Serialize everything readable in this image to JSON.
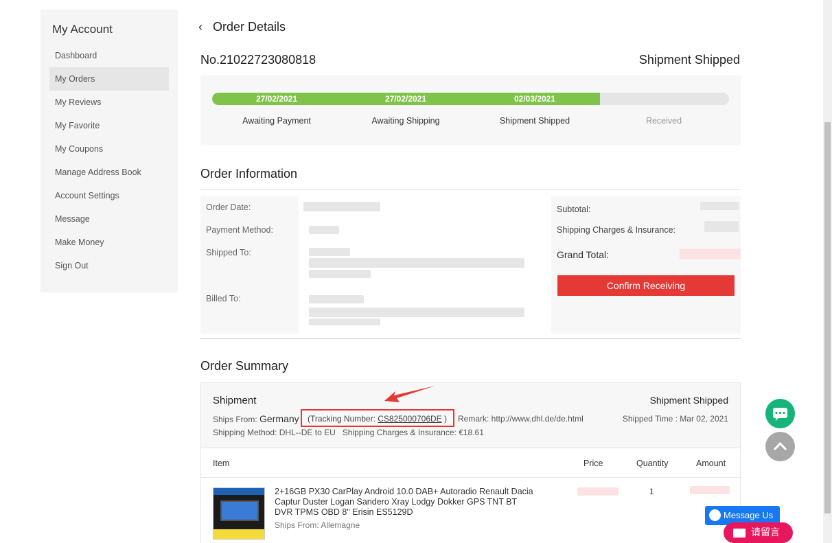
{
  "sidebar": {
    "title": "My Account",
    "items": [
      {
        "label": "Dashboard"
      },
      {
        "label": "My Orders"
      },
      {
        "label": "My Reviews"
      },
      {
        "label": "My Favorite"
      },
      {
        "label": "My Coupons"
      },
      {
        "label": "Manage Address Book"
      },
      {
        "label": "Account Settings"
      },
      {
        "label": "Message"
      },
      {
        "label": "Make Money"
      },
      {
        "label": "Sign Out"
      }
    ],
    "active": "My Orders"
  },
  "header": {
    "title": "Order Details",
    "order_no": "No.21022723080818",
    "status": "Shipment Shipped"
  },
  "progress": {
    "completed_fraction": 0.75,
    "steps": [
      {
        "date": "27/02/2021",
        "label": "Awaiting Payment",
        "done": true
      },
      {
        "date": "27/02/2021",
        "label": "Awaiting Shipping",
        "done": true
      },
      {
        "date": "02/03/2021",
        "label": "Shipment Shipped",
        "done": true
      },
      {
        "date": "",
        "label": "Received",
        "done": false
      }
    ],
    "colors": {
      "done": "#80c34a",
      "pending": "#e5e5e5"
    }
  },
  "order_info": {
    "title": "Order Information",
    "labels": {
      "order_date": "Order Date:",
      "payment_method": "Payment Method:",
      "shipped_to": "Shipped To:",
      "billed_to": "Billed To:",
      "subtotal": "Subtotal:",
      "shipping": "Shipping Charges & Insurance:",
      "grand_total": "Grand Total:"
    },
    "confirm_button": "Confirm Receiving",
    "accent": "#e53935"
  },
  "summary": {
    "title": "Order Summary",
    "shipment": {
      "title": "Shipment",
      "status": "Shipment Shipped",
      "ships_from_label": "Ships From:",
      "ships_from_value": "Germany",
      "tracking_prefix": "(Tracking Number:",
      "tracking_number": "CS825000706DE",
      "tracking_suffix": ")",
      "remark": "Remark: http://www.dhl.de/de.html",
      "shipped_time": "Shipped Time : Mar 02, 2021",
      "method": "Shipping Method: DHL--DE to EU",
      "charges": "Shipping Charges & Insurance: €18.61"
    },
    "columns": [
      "Item",
      "Price",
      "Quantity",
      "Amount"
    ],
    "items": [
      {
        "title": "2+16GB PX30 CarPlay Android 10.0 DAB+ Autoradio Renault Dacia Captur Duster Logan Sandero Xray Lodgy Dokker GPS TNT BT DVR TPMS OBD 8\" Erisin ES5129D",
        "ships_from": "Ships From: Allemagne",
        "quantity": "1"
      }
    ]
  },
  "floating": {
    "messenger": "Message Us",
    "leave_message": "请留言"
  }
}
